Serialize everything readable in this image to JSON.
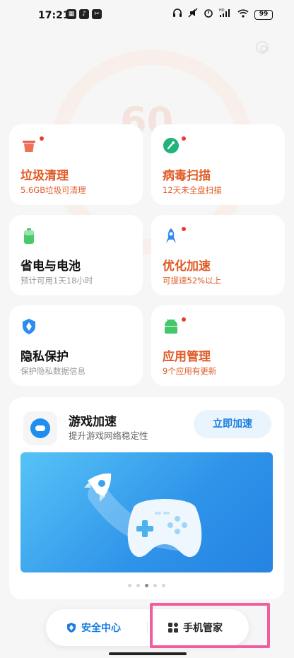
{
  "status_bar": {
    "time": "17:21",
    "app_icons": [
      "gallery-icon",
      "tiktok-icon",
      "capcut-icon"
    ],
    "right_icons": [
      "headphones-icon",
      "mute-icon",
      "alarm-icon",
      "signal-icon",
      "wifi-icon"
    ],
    "hd_label": "HD",
    "battery": "99"
  },
  "score_ring": {
    "value": "60"
  },
  "cards": [
    {
      "title": "垃圾清理",
      "sub": "5.6GB垃圾可清理",
      "icon": "trash-can-icon",
      "badge": true,
      "accent": "#e05a25"
    },
    {
      "title": "病毒扫描",
      "sub": "12天未全盘扫描",
      "icon": "virus-scan-icon",
      "badge": true,
      "accent": "#e05a25"
    },
    {
      "title": "省电与电池",
      "sub": "预计可用1天18小时",
      "icon": "battery-icon",
      "badge": false
    },
    {
      "title": "优化加速",
      "sub": "可提速52%以上",
      "icon": "rocket-icon",
      "badge": true,
      "accent": "#e05a25"
    },
    {
      "title": "隐私保护",
      "sub": "保护隐私数据信息",
      "icon": "privacy-shield-icon",
      "badge": false
    },
    {
      "title": "应用管理",
      "sub": "9个应用有更新",
      "icon": "android-app-icon",
      "badge": true,
      "accent": "#e05a25"
    }
  ],
  "game_card": {
    "title": "游戏加速",
    "sub": "提升游戏网络稳定性",
    "button": "立即加速",
    "pager": {
      "count": 5,
      "active": 3
    }
  },
  "tabbar": {
    "security_center": "安全中心",
    "phone_manager": "手机管家",
    "active": "手机管家"
  }
}
